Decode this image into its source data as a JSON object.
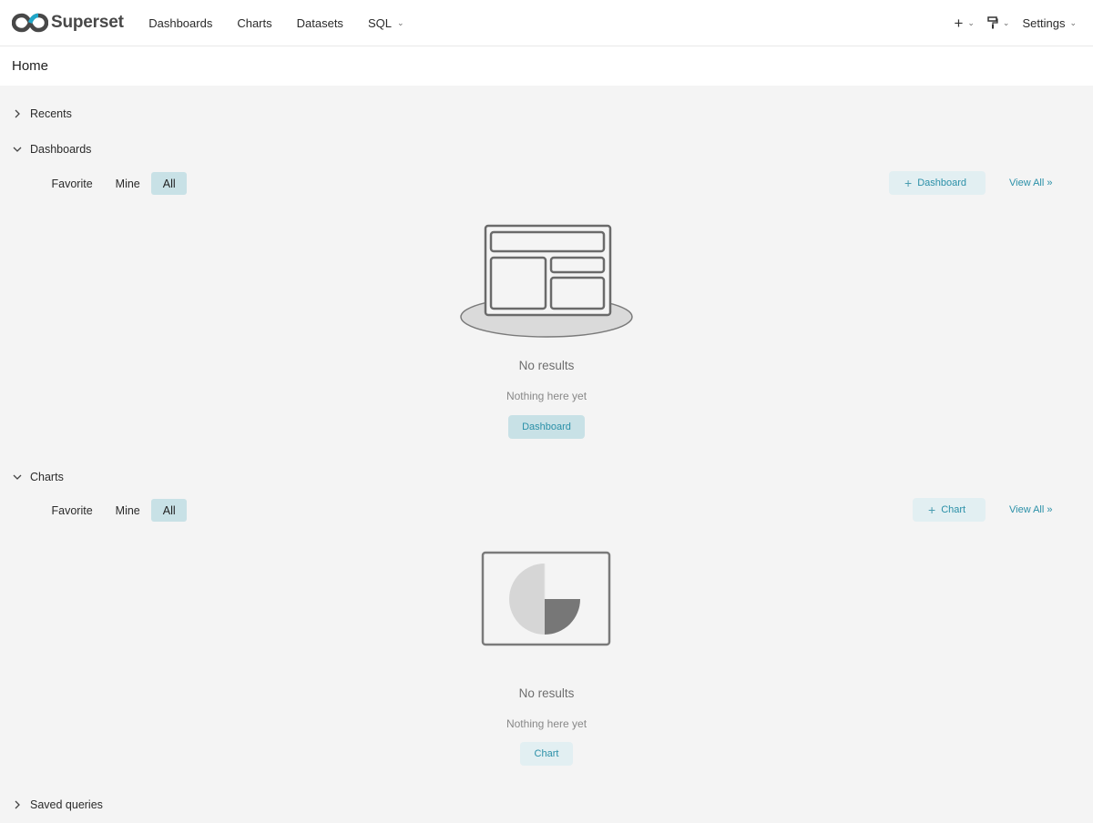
{
  "brand": {
    "name": "Superset"
  },
  "nav": {
    "items": [
      {
        "label": "Dashboards"
      },
      {
        "label": "Charts"
      },
      {
        "label": "Datasets"
      },
      {
        "label": "SQL"
      }
    ],
    "settings_label": "Settings"
  },
  "page": {
    "title": "Home"
  },
  "sections": {
    "recents": {
      "label": "Recents"
    },
    "dashboards": {
      "label": "Dashboards",
      "tabs": [
        "Favorite",
        "Mine",
        "All"
      ],
      "active_tab": "All",
      "add_label": "Dashboard",
      "view_all": "View All »",
      "empty_title": "No results",
      "empty_desc": "Nothing here yet",
      "empty_button": "Dashboard"
    },
    "charts": {
      "label": "Charts",
      "tabs": [
        "Favorite",
        "Mine",
        "All"
      ],
      "active_tab": "All",
      "add_label": "Chart",
      "view_all": "View All »",
      "empty_title": "No results",
      "empty_desc": "Nothing here yet",
      "empty_button": "Chart"
    },
    "saved_queries": {
      "label": "Saved queries"
    }
  },
  "colors": {
    "accent": "#2b90a8",
    "active_tab_bg": "#c8e1e6",
    "button_light_bg": "#e2eff2",
    "page_bg": "#f4f4f4"
  },
  "icons": {
    "logo": "superset-infinity-logo",
    "plus": "plus-icon",
    "theme": "paint-roller-icon",
    "expand": "chevron-right-icon",
    "collapse": "chevron-down-icon"
  }
}
